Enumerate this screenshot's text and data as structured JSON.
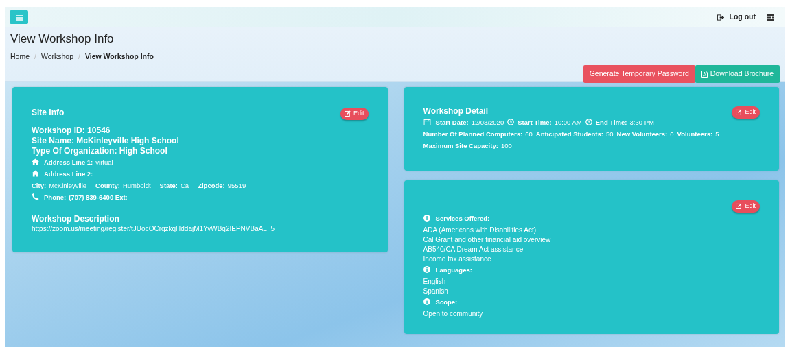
{
  "topbar": {
    "logout": "Log out"
  },
  "header": {
    "title": "View Workshop Info",
    "breadcrumb": [
      {
        "label": "Home",
        "selected": false
      },
      {
        "separator": "/",
        "label": "Workshop",
        "selected": false
      },
      {
        "separator": "/",
        "label": "View Workshop Info",
        "selected": true
      }
    ],
    "buttons": [
      {
        "label": "Generate Temporary Password",
        "kind": "danger"
      },
      {
        "label": "Download Brochure",
        "kind": "pdf"
      }
    ]
  },
  "site_info": {
    "title": "Site Info",
    "edit": "Edit",
    "rows": [
      {
        "kind": "big",
        "text": "Workshop ID: 10546"
      },
      {
        "kind": "big",
        "text": "Site Name: McKinleyville High School"
      },
      {
        "kind": "big",
        "text": "Type Of Organization: High School"
      },
      {
        "kind": "address",
        "fields": [
          {
            "label": "Address Line 1:",
            "value": "virtual"
          }
        ]
      },
      {
        "kind": "address",
        "fields": [
          {
            "label": "Address Line 2:"
          }
        ]
      },
      {
        "kind": "fields",
        "fields": [
          {
            "label": "City:",
            "value": "McKinleyville"
          },
          {
            "label": "County:",
            "value": "Humboldt"
          },
          {
            "label": "State:",
            "value": "Ca"
          },
          {
            "label": "Zipcode:",
            "value": "95519"
          }
        ]
      },
      {
        "kind": "phone",
        "fields": [
          {
            "label": "Phone:",
            "value": "(707) 839-6400 Ext:"
          }
        ]
      },
      {
        "kind": "big",
        "text": "Workshop Description"
      },
      {
        "kind": "text",
        "text": "https://zoom.us/meeting/register/tJUocOCrqzkqHddajM1YvWBq2IEPNVBaAL_5"
      }
    ]
  },
  "workshop_detail": {
    "title": "Workshop Detail",
    "edit": "Edit",
    "rows": [
      {
        "kind": "schedule",
        "fields": [
          {
            "kind": "date",
            "label": "Start Date:",
            "value": "12/03/2020"
          },
          {
            "kind": "time",
            "label": "Start Time:",
            "value": "10:00 AM"
          },
          {
            "kind": "time",
            "label": "End Time:",
            "value": "3:30 PM"
          }
        ]
      },
      {
        "kind": "fields",
        "fields": [
          {
            "label": "Number Of Planned Computers:",
            "value": "60"
          },
          {
            "label": "Anticipated Students:",
            "value": "50"
          },
          {
            "label": "New Volunteers:",
            "value": "0"
          },
          {
            "label": "Volunteers:",
            "value": "5"
          }
        ]
      },
      {
        "kind": "fields",
        "fields": [
          {
            "label": "Maximum Site Capacity:",
            "value": "100"
          }
        ]
      }
    ]
  },
  "services": {
    "edit": "Edit",
    "sections": [
      {
        "label": "Services Offered:",
        "items": [
          "ADA (Americans with Disabilities Act)",
          "Cal Grant and other financial aid overview",
          "AB540/CA Dream Act assistance",
          "Income tax assistance"
        ]
      },
      {
        "label": "Languages:",
        "items": [
          "English",
          "Spanish"
        ]
      },
      {
        "label": "Scope:",
        "items": [
          "Open to community"
        ]
      }
    ]
  }
}
